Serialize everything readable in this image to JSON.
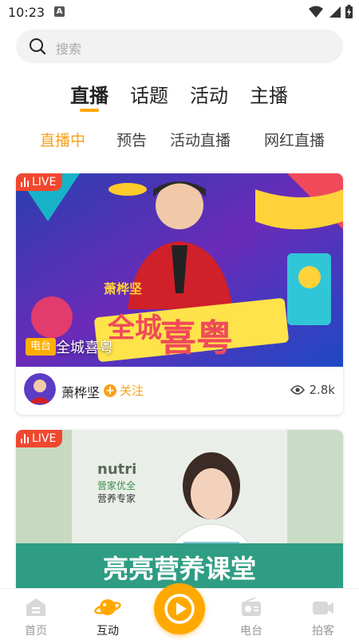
{
  "status": {
    "time": "10:23",
    "badge": "A"
  },
  "search": {
    "placeholder": "搜索"
  },
  "main_tabs": [
    {
      "label": "直播",
      "active": true
    },
    {
      "label": "话题"
    },
    {
      "label": "活动"
    },
    {
      "label": "主播"
    }
  ],
  "sub_tabs": [
    {
      "label": "直播中",
      "active": true
    },
    {
      "label": "预告"
    },
    {
      "label": "活动直播"
    },
    {
      "label": "网红直播"
    }
  ],
  "cards": [
    {
      "live_label": "LIVE",
      "category": "电台",
      "title": "全城喜粤",
      "poster_text": {
        "host": "萧桦坚",
        "show_line1": "全城",
        "show_line2": "喜粤"
      },
      "anchor": "萧桦坚",
      "follow_label": "关注",
      "views": "2.8k"
    },
    {
      "live_label": "LIVE",
      "poster_text": {
        "brand": "nutri",
        "brand_cn": "营家优全",
        "subtitle": "营养专家",
        "banner": "亮亮营养课堂"
      }
    }
  ],
  "bottom_nav": [
    {
      "label": "首页",
      "icon": "home-icon"
    },
    {
      "label": "互动",
      "icon": "planet-icon",
      "active": true
    },
    {
      "label": "",
      "icon": "play-icon"
    },
    {
      "label": "电台",
      "icon": "radio-icon"
    },
    {
      "label": "拍客",
      "icon": "video-camera-icon"
    }
  ],
  "colors": {
    "accent": "#ffa800",
    "live": "#f1472f",
    "muted": "#999999"
  }
}
